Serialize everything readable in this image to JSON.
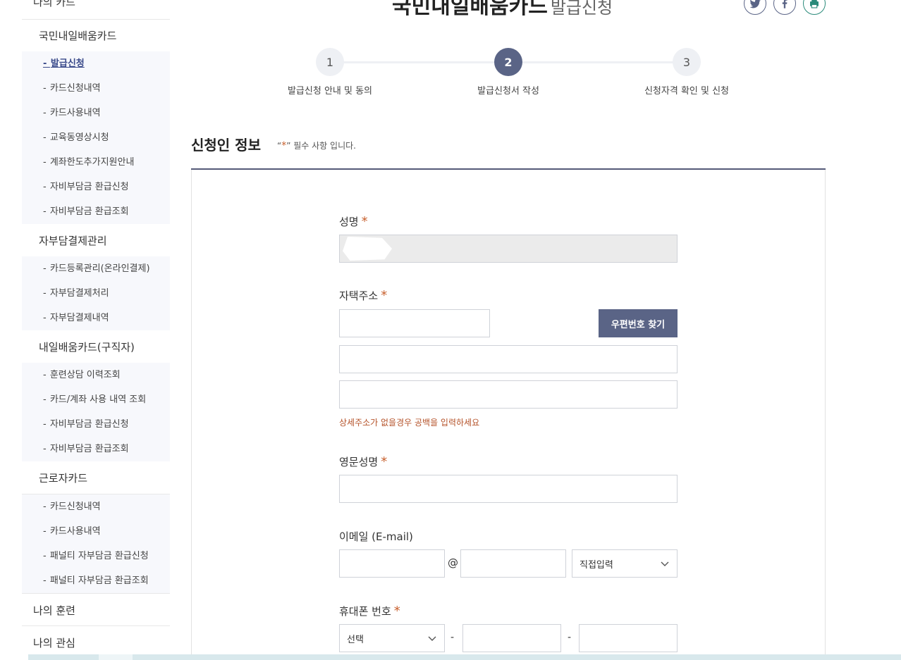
{
  "sidebar": {
    "top_label": "나의 카드",
    "sections": [
      {
        "title": "국민내일배움카드",
        "items": [
          "발급신청",
          "카드신청내역",
          "카드사용내역",
          "교육동영상시청",
          "계좌한도추가지원안내",
          "자비부담금 환급신청",
          "자비부담금 환급조회"
        ]
      },
      {
        "title": "자부담결제관리",
        "items": [
          "카드등록관리(온라인결제)",
          "자부담결제처리",
          "자부담결제내역"
        ]
      },
      {
        "title": "내일배움카드(구직자)",
        "items": [
          "훈련상담 이력조회",
          "카드/계좌 사용 내역 조회",
          "자비부담금 환급신청",
          "자비부담금 환급조회"
        ]
      },
      {
        "title": "근로자카드",
        "items": [
          "카드신청내역",
          "카드사용내역",
          "패널티 자부담금 환급신청",
          "패널티 자부담금 환급조회"
        ]
      }
    ],
    "bottom_links": [
      "나의 훈련",
      "나의 관심"
    ],
    "item_prefix": "- "
  },
  "header": {
    "title": "국민내일배움카드",
    "subtitle": "발급신청",
    "share_icons": [
      "twitter-icon",
      "facebook-icon",
      "print-icon"
    ]
  },
  "steps": [
    {
      "number": "1",
      "label": "발급신청 안내 및 동의",
      "active": false
    },
    {
      "number": "2",
      "label": "발급신청서 작성",
      "active": true
    },
    {
      "number": "3",
      "label": "신청자격 확인 및 신청",
      "active": false
    }
  ],
  "section": {
    "title": "신청인 정보",
    "required_note_prefix": "“",
    "required_note_star": "*",
    "required_note_suffix": "” 필수 사항 입니다."
  },
  "form": {
    "name_label": "성명",
    "name_value": "",
    "address_label": "자택주소",
    "zip_button": "우편번호 찾기",
    "address_hint": "상세주소가 없을경우 공백을 입력하세요",
    "english_name_label": "영문성명",
    "email_label": "이메일 (E-mail)",
    "email_at": "@",
    "email_domain_select": "직접입력",
    "phone_label": "휴대폰 번호",
    "phone_prefix_select": "선택",
    "phone_separator": "-",
    "required_star": "*"
  },
  "colors": {
    "accent": "#5a6486",
    "required": "#c8612f",
    "hint": "#b5532a"
  }
}
